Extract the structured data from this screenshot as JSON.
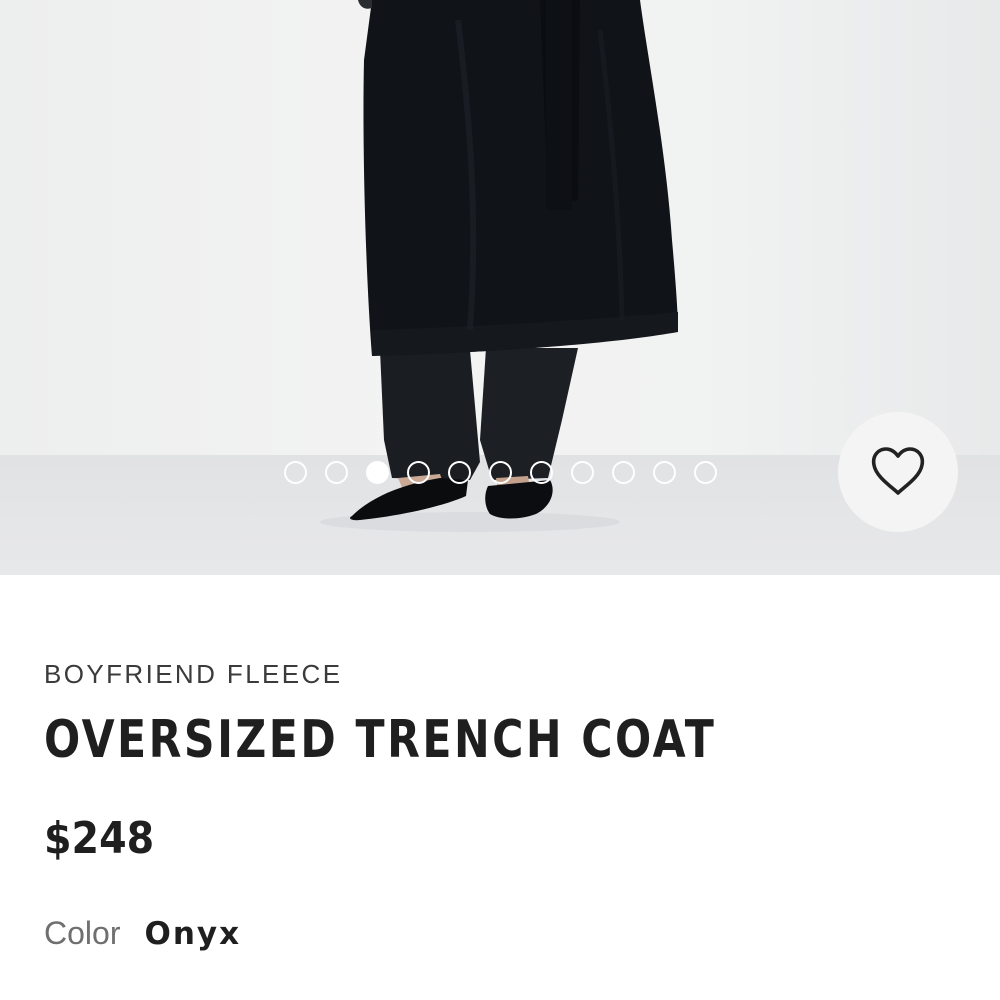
{
  "gallery": {
    "image_alt": "Model wearing oversized trench coat in Onyx",
    "dot_count": 11,
    "active_dot_index": 2
  },
  "wishlist": {
    "icon": "heart-icon"
  },
  "product": {
    "brand": "BOYFRIEND FLEECE",
    "title": "OVERSIZED TRENCH COAT",
    "price": "$248",
    "color_label": "Color",
    "color_value": "Onyx"
  },
  "colors": {
    "garment": "#111418",
    "text_primary": "#1f1f1f",
    "text_secondary": "#6f6f6f"
  }
}
